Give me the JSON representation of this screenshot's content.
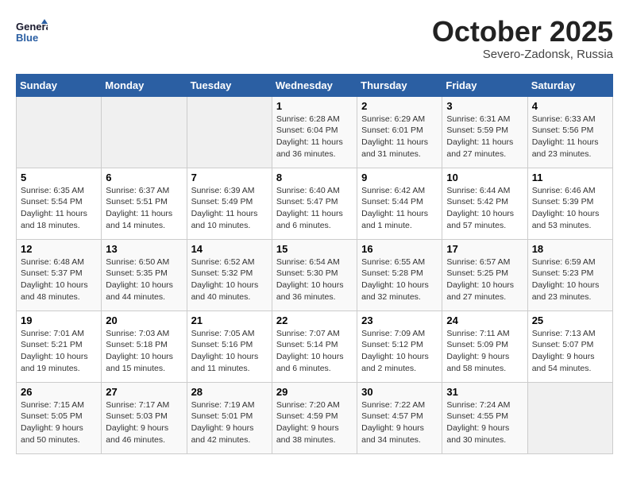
{
  "header": {
    "logo_text_general": "General",
    "logo_text_blue": "Blue",
    "month": "October 2025",
    "location": "Severo-Zadonsk, Russia"
  },
  "weekdays": [
    "Sunday",
    "Monday",
    "Tuesday",
    "Wednesday",
    "Thursday",
    "Friday",
    "Saturday"
  ],
  "weeks": [
    [
      {
        "day": "",
        "info": ""
      },
      {
        "day": "",
        "info": ""
      },
      {
        "day": "",
        "info": ""
      },
      {
        "day": "1",
        "info": "Sunrise: 6:28 AM\nSunset: 6:04 PM\nDaylight: 11 hours\nand 36 minutes."
      },
      {
        "day": "2",
        "info": "Sunrise: 6:29 AM\nSunset: 6:01 PM\nDaylight: 11 hours\nand 31 minutes."
      },
      {
        "day": "3",
        "info": "Sunrise: 6:31 AM\nSunset: 5:59 PM\nDaylight: 11 hours\nand 27 minutes."
      },
      {
        "day": "4",
        "info": "Sunrise: 6:33 AM\nSunset: 5:56 PM\nDaylight: 11 hours\nand 23 minutes."
      }
    ],
    [
      {
        "day": "5",
        "info": "Sunrise: 6:35 AM\nSunset: 5:54 PM\nDaylight: 11 hours\nand 18 minutes."
      },
      {
        "day": "6",
        "info": "Sunrise: 6:37 AM\nSunset: 5:51 PM\nDaylight: 11 hours\nand 14 minutes."
      },
      {
        "day": "7",
        "info": "Sunrise: 6:39 AM\nSunset: 5:49 PM\nDaylight: 11 hours\nand 10 minutes."
      },
      {
        "day": "8",
        "info": "Sunrise: 6:40 AM\nSunset: 5:47 PM\nDaylight: 11 hours\nand 6 minutes."
      },
      {
        "day": "9",
        "info": "Sunrise: 6:42 AM\nSunset: 5:44 PM\nDaylight: 11 hours\nand 1 minute."
      },
      {
        "day": "10",
        "info": "Sunrise: 6:44 AM\nSunset: 5:42 PM\nDaylight: 10 hours\nand 57 minutes."
      },
      {
        "day": "11",
        "info": "Sunrise: 6:46 AM\nSunset: 5:39 PM\nDaylight: 10 hours\nand 53 minutes."
      }
    ],
    [
      {
        "day": "12",
        "info": "Sunrise: 6:48 AM\nSunset: 5:37 PM\nDaylight: 10 hours\nand 48 minutes."
      },
      {
        "day": "13",
        "info": "Sunrise: 6:50 AM\nSunset: 5:35 PM\nDaylight: 10 hours\nand 44 minutes."
      },
      {
        "day": "14",
        "info": "Sunrise: 6:52 AM\nSunset: 5:32 PM\nDaylight: 10 hours\nand 40 minutes."
      },
      {
        "day": "15",
        "info": "Sunrise: 6:54 AM\nSunset: 5:30 PM\nDaylight: 10 hours\nand 36 minutes."
      },
      {
        "day": "16",
        "info": "Sunrise: 6:55 AM\nSunset: 5:28 PM\nDaylight: 10 hours\nand 32 minutes."
      },
      {
        "day": "17",
        "info": "Sunrise: 6:57 AM\nSunset: 5:25 PM\nDaylight: 10 hours\nand 27 minutes."
      },
      {
        "day": "18",
        "info": "Sunrise: 6:59 AM\nSunset: 5:23 PM\nDaylight: 10 hours\nand 23 minutes."
      }
    ],
    [
      {
        "day": "19",
        "info": "Sunrise: 7:01 AM\nSunset: 5:21 PM\nDaylight: 10 hours\nand 19 minutes."
      },
      {
        "day": "20",
        "info": "Sunrise: 7:03 AM\nSunset: 5:18 PM\nDaylight: 10 hours\nand 15 minutes."
      },
      {
        "day": "21",
        "info": "Sunrise: 7:05 AM\nSunset: 5:16 PM\nDaylight: 10 hours\nand 11 minutes."
      },
      {
        "day": "22",
        "info": "Sunrise: 7:07 AM\nSunset: 5:14 PM\nDaylight: 10 hours\nand 6 minutes."
      },
      {
        "day": "23",
        "info": "Sunrise: 7:09 AM\nSunset: 5:12 PM\nDaylight: 10 hours\nand 2 minutes."
      },
      {
        "day": "24",
        "info": "Sunrise: 7:11 AM\nSunset: 5:09 PM\nDaylight: 9 hours\nand 58 minutes."
      },
      {
        "day": "25",
        "info": "Sunrise: 7:13 AM\nSunset: 5:07 PM\nDaylight: 9 hours\nand 54 minutes."
      }
    ],
    [
      {
        "day": "26",
        "info": "Sunrise: 7:15 AM\nSunset: 5:05 PM\nDaylight: 9 hours\nand 50 minutes."
      },
      {
        "day": "27",
        "info": "Sunrise: 7:17 AM\nSunset: 5:03 PM\nDaylight: 9 hours\nand 46 minutes."
      },
      {
        "day": "28",
        "info": "Sunrise: 7:19 AM\nSunset: 5:01 PM\nDaylight: 9 hours\nand 42 minutes."
      },
      {
        "day": "29",
        "info": "Sunrise: 7:20 AM\nSunset: 4:59 PM\nDaylight: 9 hours\nand 38 minutes."
      },
      {
        "day": "30",
        "info": "Sunrise: 7:22 AM\nSunset: 4:57 PM\nDaylight: 9 hours\nand 34 minutes."
      },
      {
        "day": "31",
        "info": "Sunrise: 7:24 AM\nSunset: 4:55 PM\nDaylight: 9 hours\nand 30 minutes."
      },
      {
        "day": "",
        "info": ""
      }
    ]
  ]
}
